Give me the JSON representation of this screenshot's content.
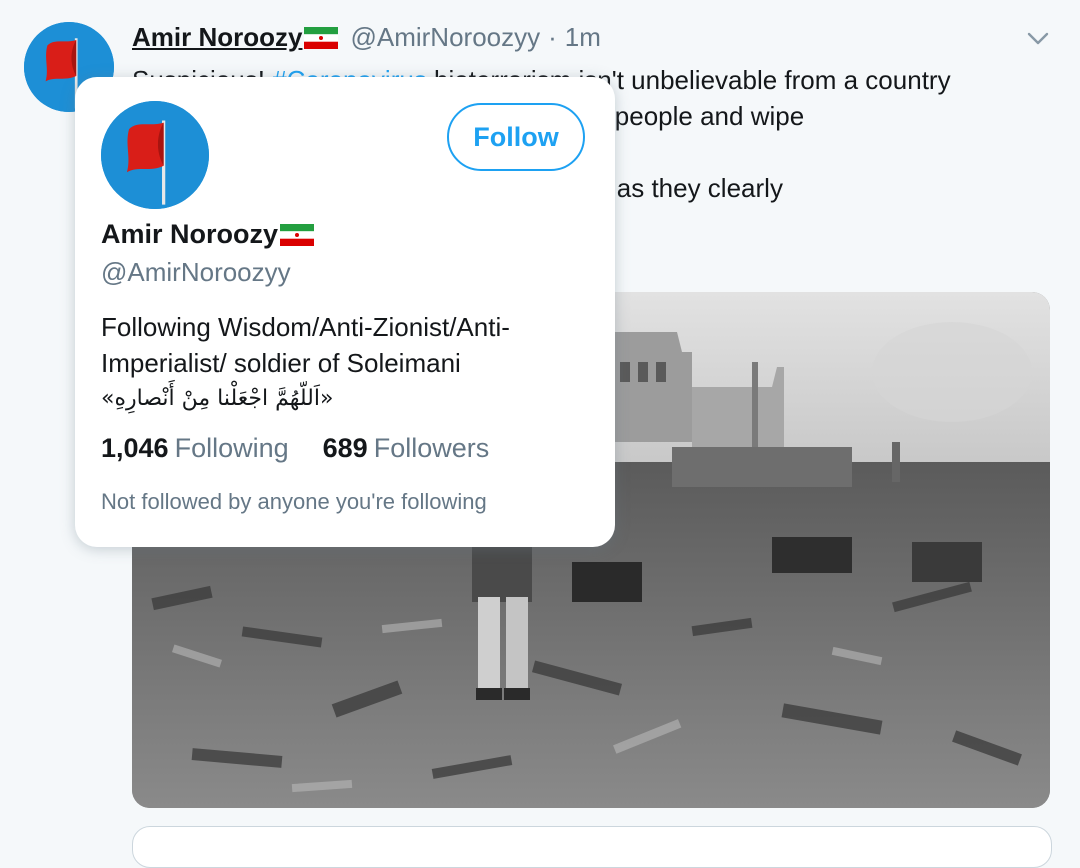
{
  "tweet": {
    "author_name": "Amir Noroozy",
    "author_handle": "@AmirNoroozyy",
    "separator": "·",
    "time": "1m",
    "text_lines": [
      {
        "hashtag": "#Coronavirus",
        "rest": " bioterrorism isn't unbelievable from a country",
        "prefix": "Suspicious! "
      },
      {
        "text": "that dropped an atomic bomb on 220,000 people and wipe"
      },
      {
        "text": ""
      },
      {
        "text": "It isn't hard to believe anymore for the US as they clearly"
      }
    ]
  },
  "hovercard": {
    "name": "Amir Noroozy",
    "handle": "@AmirNoroozyy",
    "follow_label": "Follow",
    "bio_lines": [
      "Following Wisdom/Anti-Zionist/Anti-",
      "Imperialist/ soldier of Soleimani",
      "«اَللّهُمَّ اجْعَلْنا مِنْ أَنْصارِهِ»"
    ],
    "following_count": "1,046",
    "following_label": "Following",
    "followers_count": "689",
    "followers_label": "Followers",
    "note": "Not followed by anyone you're following"
  },
  "icons": {
    "avatar": "red-flag-avatar",
    "flag": "iran-flag-emoji",
    "menu": "chevron-down-icon"
  },
  "colors": {
    "accent": "#1da1f2",
    "secondary_text": "#657786",
    "avatar_bg": "#1d8fd6",
    "flag_red": "#d91e18"
  }
}
